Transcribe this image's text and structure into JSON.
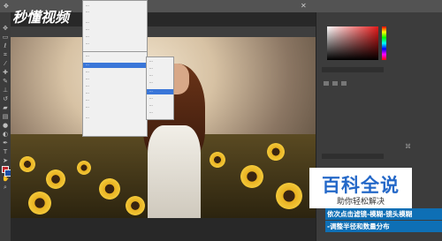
{
  "logo": {
    "text": "秒懂视频"
  },
  "watermark": {
    "title": "百科全说",
    "subtitle": "助你轻松解决"
  },
  "caption": {
    "line1": "依次点击滤镜-模糊-镜头模糊",
    "line2": "-调整半径和数量分布"
  },
  "colors": {
    "highlight": "#3a76d8",
    "panel_bg": "#3c3c3c",
    "caption_bg": "#0e6fb5",
    "watermark_blue": "#2468c8"
  },
  "icons": [
    "move-icon",
    "marquee-icon",
    "lasso-icon",
    "brush-icon",
    "eraser-icon",
    "text-icon",
    "zoom-icon",
    "foreground-color-icon"
  ]
}
